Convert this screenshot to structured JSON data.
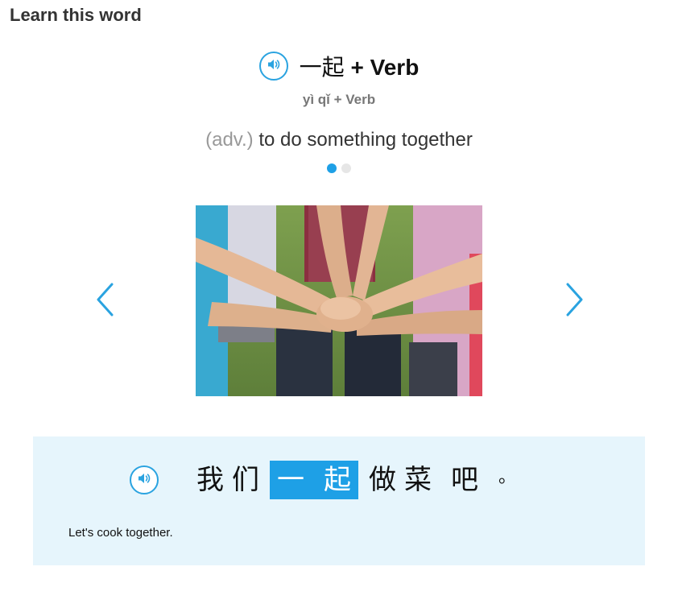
{
  "header": {
    "title": "Learn this word"
  },
  "word": {
    "hanzi": "一起",
    "suffix": " + Verb",
    "pinyin": "yì qǐ + Verb",
    "part_of_speech": "(adv.)",
    "definition": " to do something together",
    "audio_icon": "speaker-icon"
  },
  "carousel": {
    "dots": 2,
    "active_index": 0,
    "prev_icon": "chevron-left-icon",
    "next_icon": "chevron-right-icon"
  },
  "example": {
    "chars_before": [
      "我",
      "们"
    ],
    "highlight": [
      "一",
      "起"
    ],
    "chars_after": [
      "做",
      "菜",
      "吧"
    ],
    "period": "。",
    "translation": "Let's cook together.",
    "audio_icon": "speaker-icon"
  },
  "colors": {
    "accent": "#1ea0e6",
    "panel_bg": "#e6f5fc",
    "title": "#333333",
    "muted": "#999999"
  }
}
